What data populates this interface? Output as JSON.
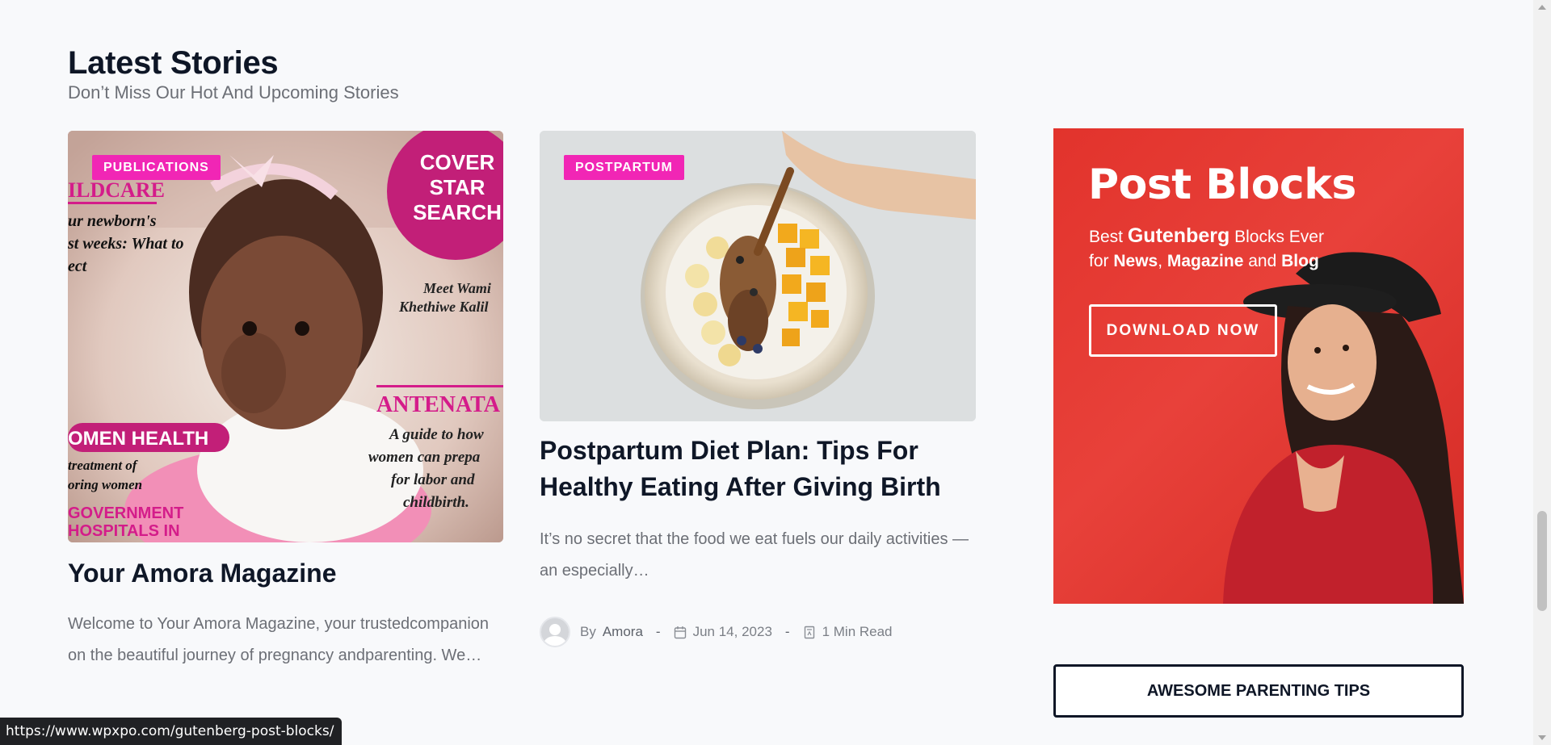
{
  "section": {
    "title": "Latest Stories",
    "subtitle": "Don’t Miss Our Hot And Upcoming Stories"
  },
  "posts": [
    {
      "category": "Publications",
      "title": "Your Amora Magazine",
      "excerpt": "Welcome to Your Amora Magazine, your trustedcompanion on the beautiful journey of pregnancy andparenting. We…",
      "image_text": {
        "cover_star": [
          "COVER",
          "STAR",
          "SEARCH"
        ],
        "childcare": "ILDCARE",
        "newborn": [
          "ur newborn's",
          "st weeks: What to",
          "ect"
        ],
        "meet": [
          "Meet Wami",
          "Khethiwe Kalil"
        ],
        "antenatal": "ANTENATA",
        "antenatal_text": [
          "A guide to how",
          "women can prepa",
          "for labor and",
          "childbirth."
        ],
        "women_health": "OMEN HEALTH",
        "treatment": [
          "treatment of",
          "oring women"
        ],
        "government": [
          "GOVERNMENT",
          "HOSPITALS IN"
        ]
      }
    },
    {
      "category": "Postpartum",
      "title": "Postpartum Diet Plan: Tips For Healthy Eating After Giving Birth",
      "excerpt": "It’s no secret that the food we eat fuels our daily activities — an especially…",
      "meta": {
        "by": "By",
        "author": "Amora",
        "separator": "-",
        "date": "Jun 14, 2023",
        "read_time": "1 Min Read"
      }
    }
  ],
  "ad": {
    "title": "Post Blocks",
    "line1_pre": "Best ",
    "line1_bold": "Gutenberg",
    "line1_post": " Blocks Ever",
    "line2_pre": "for ",
    "line2_bold1": "News",
    "line2_mid1": ", ",
    "line2_bold2": "Magazine",
    "line2_mid2": " and ",
    "line2_bold3": "Blog",
    "button": "DOWNLOAD NOW"
  },
  "tips_button": "AWESOME PARENTING TIPS",
  "status_url": "https://www.wpxpo.com/gutenberg-post-blocks/",
  "colors": {
    "accent_pink": "#f126b5",
    "ad_red": "#e2332c",
    "text_dark": "#0f1727"
  },
  "icons": {
    "date": "calendar-icon",
    "read": "book-icon",
    "avatar": "user-avatar-icon"
  }
}
